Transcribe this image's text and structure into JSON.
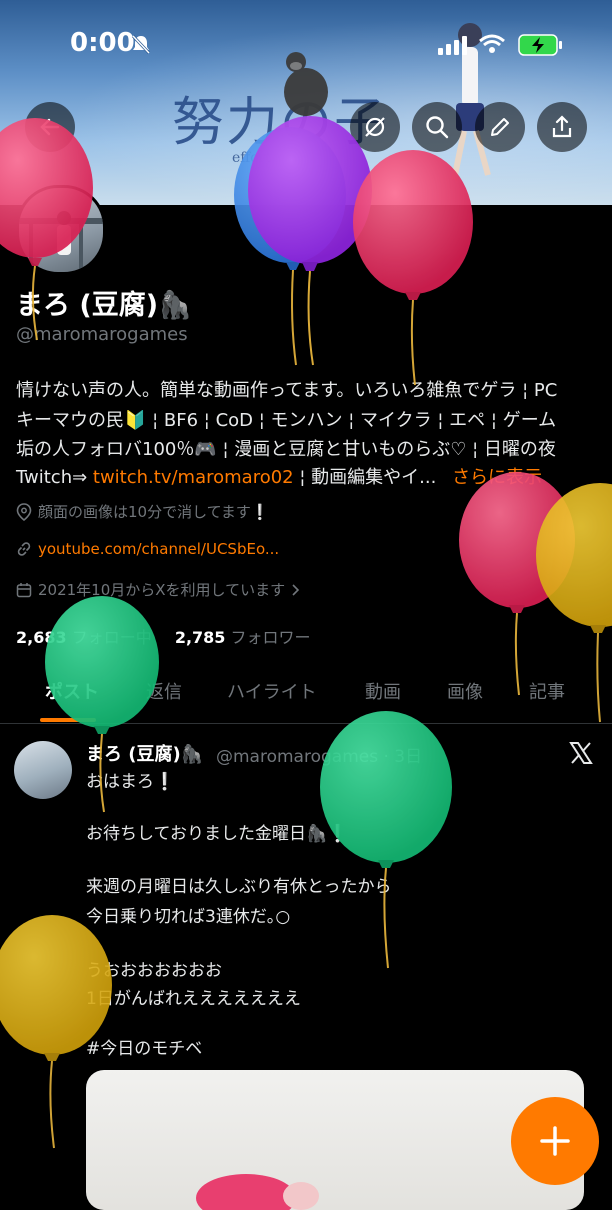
{
  "status": {
    "time": "0:00"
  },
  "banner": {
    "title": "努力の子",
    "subtitle": "effort"
  },
  "profile": {
    "name": "まろ (豆腐)🦍",
    "handle": "@maromarogames",
    "bio_lines": [
      "情けない声の人。簡単な動画作ってます。いろいろ雑魚でゲラ ¦ PC",
      "キーマウの民🔰 ¦ BF6 ¦ CoD ¦ モンハン ¦ マイクラ ¦ エペ ¦ ゲーム",
      "垢の人フォロバ100％🎮 ¦ 漫画と豆腐と甘いものらぶ♡ ¦ 日曜の夜"
    ],
    "bio_last_prefix": "Twitch⇒ ",
    "bio_link": "twitch.tv/maromaro02",
    "bio_last_suffix": " ¦ 動画編集やイ...",
    "show_more": "さらに表示",
    "location": "顔面の画像は10分で消してます❕",
    "website": "youtube.com/channel/UCSbEo...",
    "joined": "2021年10月からXを利用しています",
    "following_count": "2,683",
    "following_label": "フォロー中",
    "followers_count": "2,785",
    "followers_label": "フォロワー"
  },
  "tabs": [
    "ポスト",
    "返信",
    "ハイライト",
    "動画",
    "画像",
    "記事"
  ],
  "post": {
    "name": "まろ (豆腐)🦍",
    "handle": "@maromarogames · 3日",
    "lines": [
      "おはまろ❕",
      "",
      "お待ちしておりました金曜日🦍❕",
      "",
      "来週の月曜日は久しぶり有休とったから",
      "今日乗り切れば3連休だ｡○",
      "",
      "うおおおおおおお",
      "1日がんばれえええええええ"
    ],
    "hashtag": "#今日のモチベ"
  },
  "colors": {
    "accent": "#ff7a00",
    "background": "#000000",
    "muted": "#71767b"
  },
  "overlay": {
    "type": "balloons"
  }
}
